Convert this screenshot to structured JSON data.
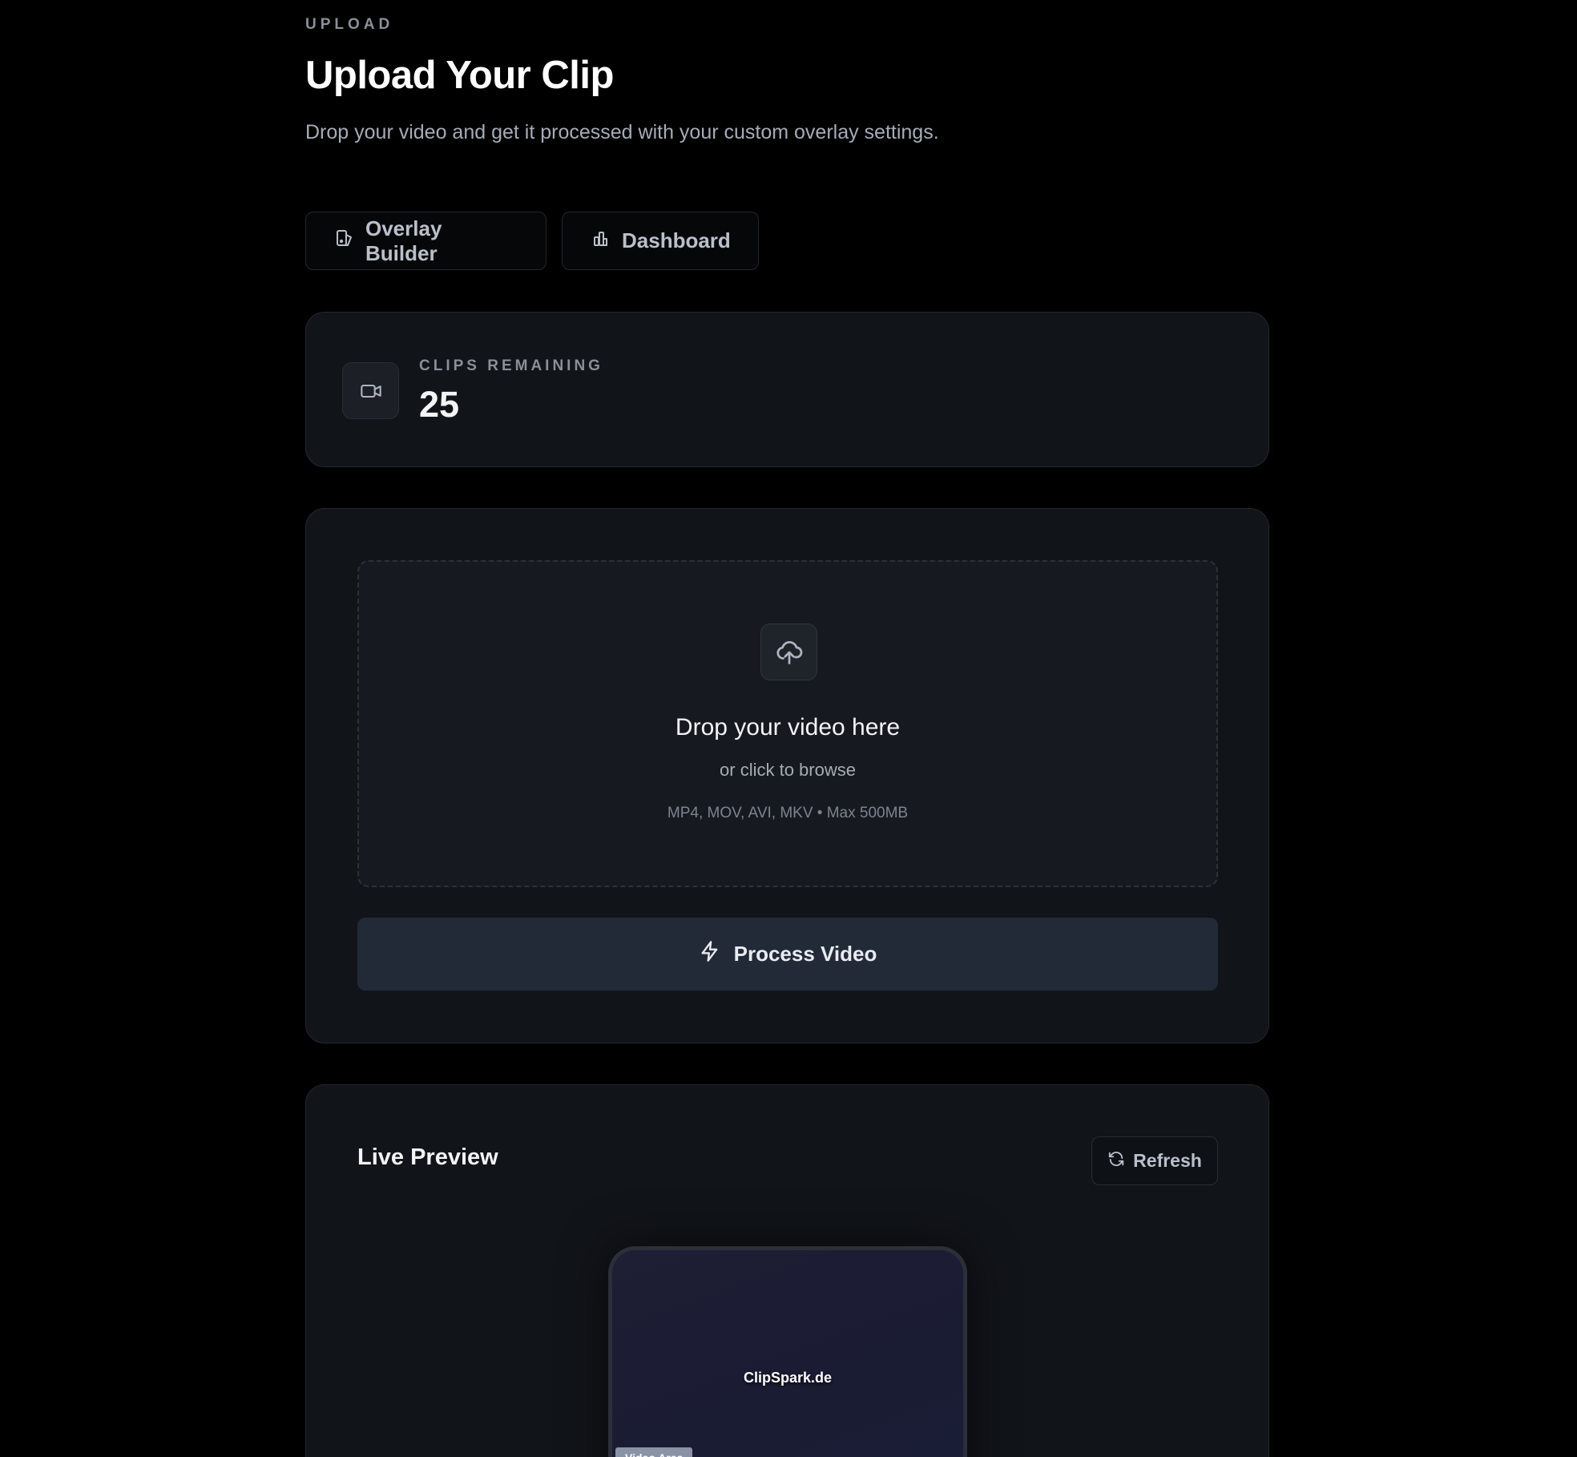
{
  "header": {
    "eyebrow": "UPLOAD",
    "title": "Upload Your Clip",
    "subtitle": "Drop your video and get it processed with your custom overlay settings."
  },
  "nav": {
    "overlay_builder": {
      "label": "Overlay Builder",
      "icon": "overlay-icon"
    },
    "dashboard": {
      "label": "Dashboard",
      "icon": "bar-chart-icon"
    }
  },
  "stats": {
    "label": "CLIPS REMAINING",
    "value": "25",
    "icon": "video-camera-icon"
  },
  "upload": {
    "icon": "cloud-upload-icon",
    "title": "Drop your video here",
    "subtitle": "or click to browse",
    "formats": "MP4, MOV, AVI, MKV • Max 500MB",
    "process_label": "Process Video",
    "process_icon": "lightning-icon"
  },
  "preview": {
    "title": "Live Preview",
    "refresh_label": "Refresh",
    "refresh_icon": "refresh-icon",
    "brand_text": "ClipSpark.de",
    "video_area_label": "Video Area"
  },
  "colors": {
    "background": "#000000",
    "card": "#111419",
    "accent_button": "#222a37"
  }
}
